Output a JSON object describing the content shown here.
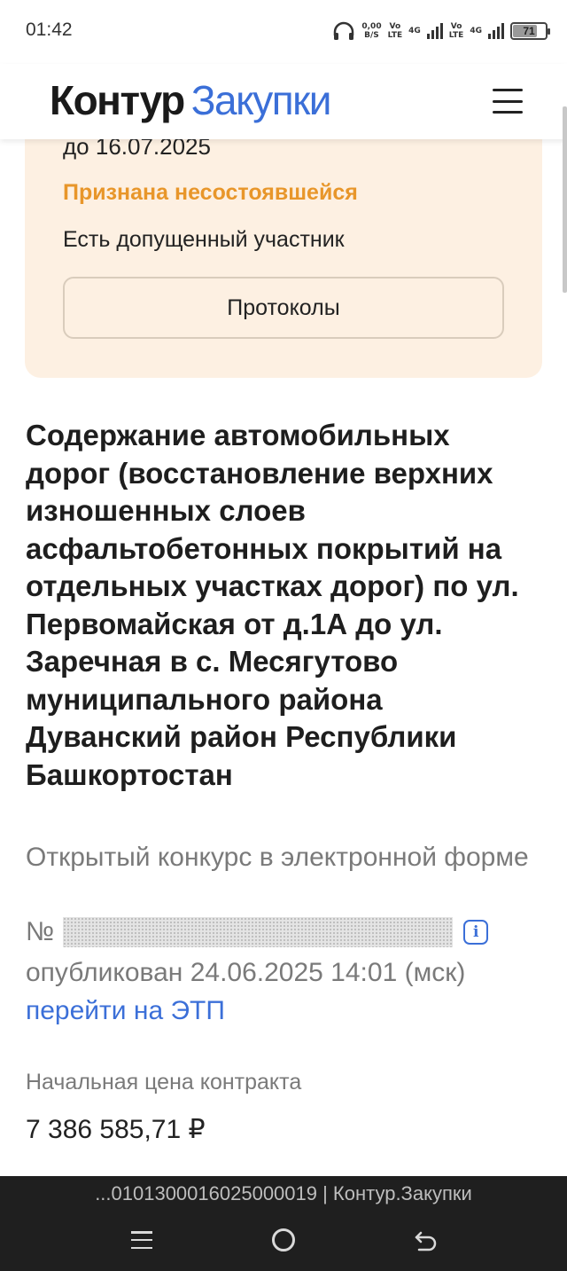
{
  "status_bar": {
    "time": "01:42",
    "net_speed_value": "0,00",
    "net_speed_unit": "B/S",
    "sim1_vo": "Vo",
    "sim1_lte": "LTE",
    "sim1_gen": "4G",
    "sim2_vo": "Vo",
    "sim2_lte": "LTE",
    "sim2_gen": "4G",
    "battery_level": "71"
  },
  "header": {
    "logo_part1": "Контур",
    "logo_part2": "Закупки",
    "accent_color": "#3b6fd8"
  },
  "status_card": {
    "date_text": "до 16.07.2025",
    "status": "Признана несостоявшейся",
    "status_color": "#e8962a",
    "note": "Есть допущенный участник",
    "protocols_button": "Протоколы"
  },
  "tender": {
    "title": "Содержание автомобильных дорог (восстановление верхних изношенных слоев асфальтобетонных покрытий на отдельных участках дорог) по ул. Первомайская от д.1А до ул. Заречная в с. Месягутово муниципального района Дуванский район Республики Башкортостан",
    "procedure_type": "Открытый конкурс в электронной форме",
    "number_prefix": "№",
    "published": "опубликован 24.06.2025 14:01 (мск)",
    "etp_link": "перейти на ЭТП",
    "price_label": "Начальная цена контракта",
    "price_value": "7 386 585,71 ₽"
  },
  "browser": {
    "url_title": "...0101300016025000019 | Контур.Закупки"
  }
}
